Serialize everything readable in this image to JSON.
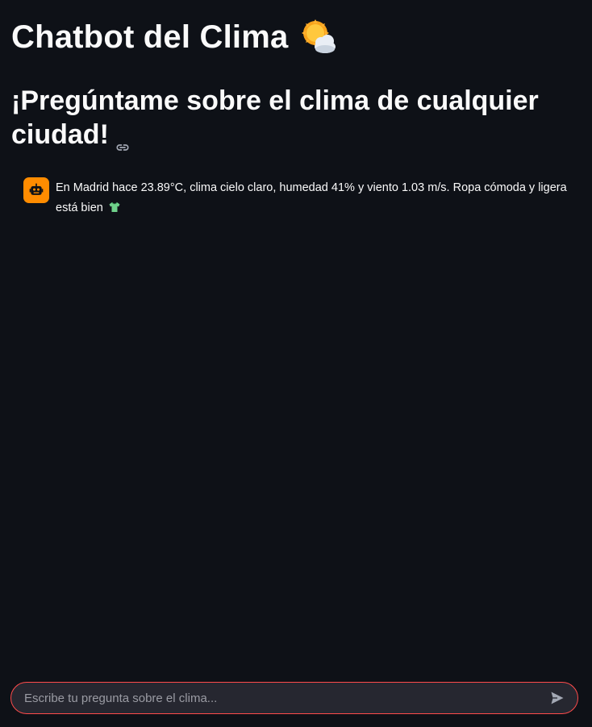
{
  "header": {
    "title": "Chatbot del Clima",
    "title_icon": "sun-behind-cloud-icon",
    "subtitle": "¡Pregúntame sobre el clima de cualquier ciudad!",
    "subtitle_icon": "link-icon"
  },
  "messages": [
    {
      "role": "assistant",
      "avatar_icon": "robot-icon",
      "text": "En Madrid hace 23.89°C, clima cielo claro, humedad 41% y viento 1.03 m/s. Ropa cómoda y ligera está bien",
      "trailing_icon": "t-shirt-icon"
    }
  ],
  "chat_input": {
    "placeholder": "Escribe tu pregunta sobre el clima...",
    "value": "",
    "send_icon": "send-icon"
  },
  "colors": {
    "background": "#0e1117",
    "text": "#fafafa",
    "avatar_bg": "#ff8c00",
    "input_bg": "#262730",
    "input_border": "#ff4b4b"
  }
}
